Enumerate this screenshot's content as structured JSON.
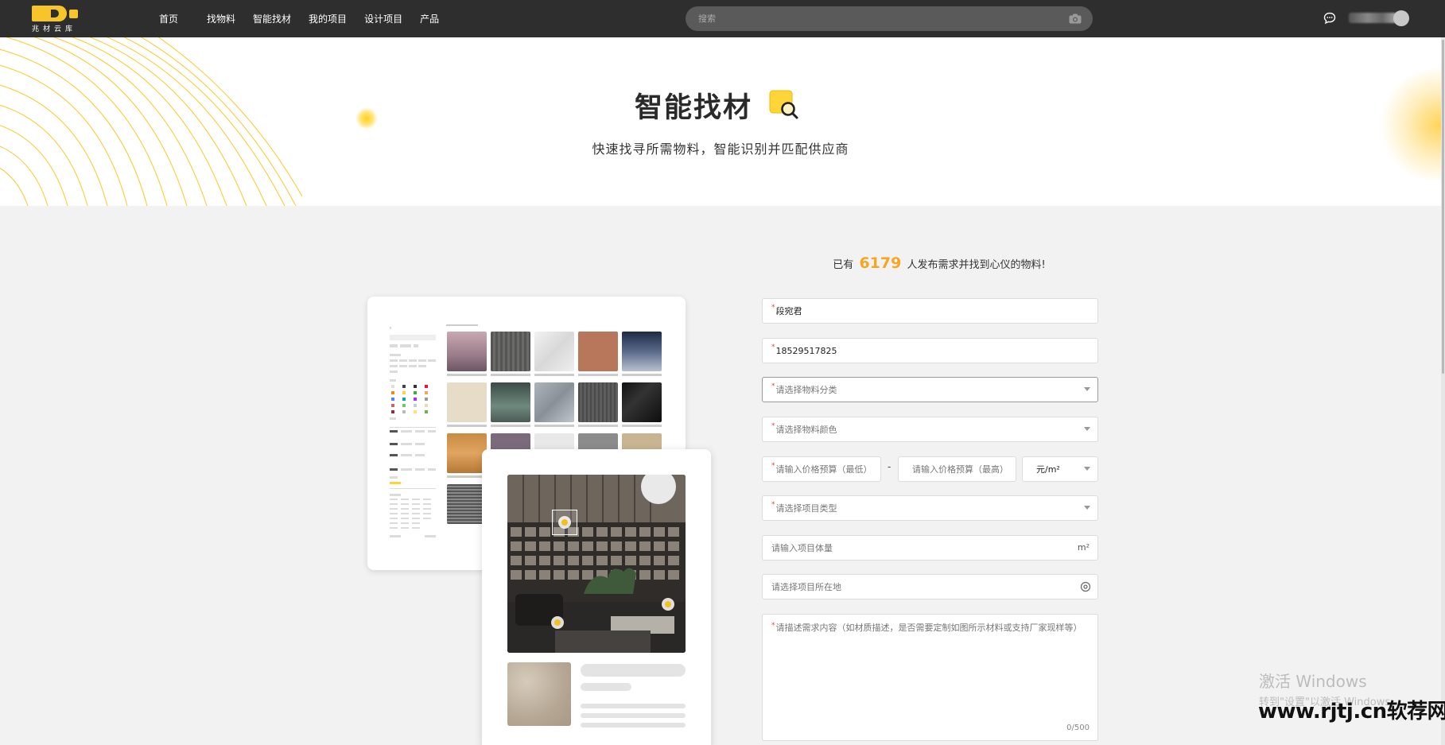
{
  "brand": {
    "logo_text": "兆材云库",
    "accent": "#f7c52a"
  },
  "nav": {
    "items": [
      "首页",
      "找物料",
      "智能找材",
      "我的项目",
      "设计项目",
      "产品"
    ]
  },
  "search": {
    "placeholder": "搜索"
  },
  "hero": {
    "title": "智能找材",
    "subtitle": "快速找寻所需物料，智能识别并匹配供应商"
  },
  "stats": {
    "prefix": "已有",
    "count": "6179",
    "suffix": "人发布需求并找到心仪的物料!"
  },
  "form": {
    "name": "段宛君",
    "phone": "18529517825",
    "category_placeholder": "请选择物料分类",
    "color_placeholder": "请选择物料颜色",
    "price_min_placeholder": "请输入价格预算（最低）",
    "price_separator": "-",
    "price_max_placeholder": "请输入价格预算（最高）",
    "price_unit": "元/m²",
    "project_type_placeholder": "请选择项目类型",
    "volume_placeholder": "请输入项目体量",
    "volume_unit": "m²",
    "location_placeholder": "请选择项目所在地",
    "desc_placeholder": "请描述需求内容（如材质描述，是否需要定制如图所示材料或支持厂家现样等）",
    "desc_counter": "0/500"
  },
  "watermark": {
    "windows_line1": "激活 Windows",
    "windows_line2": "转到\"设置\"以激活 Windows。",
    "site": "www.rjtj.cn软荐网"
  }
}
